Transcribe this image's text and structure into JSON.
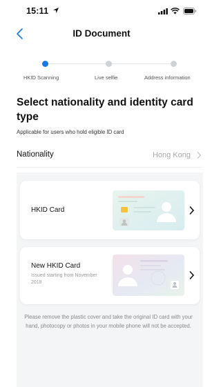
{
  "status_bar": {
    "time": "15:11"
  },
  "nav": {
    "title": "ID Document"
  },
  "steps": [
    {
      "label": "HKID Scanning",
      "state": "active"
    },
    {
      "label": "Live selfie",
      "state": "inactive"
    },
    {
      "label": "Address information",
      "state": "inactive"
    }
  ],
  "main": {
    "heading": "Select nationality and identity card type",
    "subtext": "Applicable for users who hold eligible ID card",
    "nationality_label": "Nationality",
    "nationality_value": "Hong Kong"
  },
  "cards": [
    {
      "title": "HKID Card",
      "subtitle": ""
    },
    {
      "title": "New HKID Card",
      "subtitle": "Issued starting from November 2018"
    }
  ],
  "footnote": "Please remove the plastic cover and take the original ID card with your hand, photocopy or photos in your mobile phone will not be accepted.",
  "colors": {
    "accent": "#1677e6",
    "inactive": "#cfd3d8",
    "card_bg": "#f4f5f7"
  }
}
